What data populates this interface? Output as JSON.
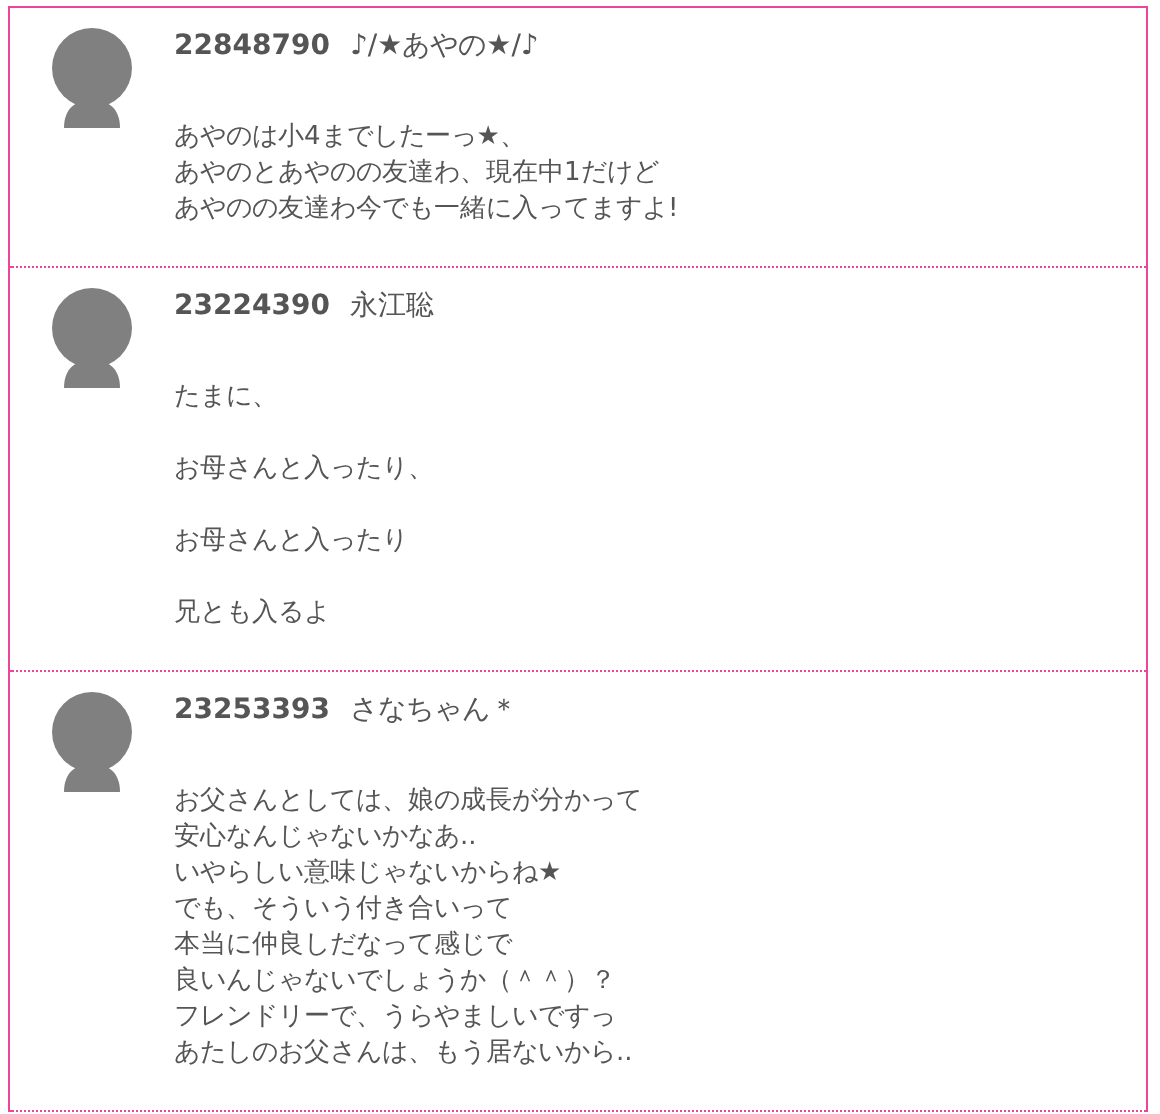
{
  "posts": [
    {
      "id": "22848790",
      "name": "♪/★あやの★/♪",
      "paragraphs": [
        [
          "あやのは小4までしたーっ★、",
          "あやのとあやのの友達わ、現在中1だけど",
          "あやのの友達わ今でも一緒に入ってますよ!"
        ]
      ]
    },
    {
      "id": "23224390",
      "name": "永江聡",
      "paragraphs": [
        [
          "たまに、"
        ],
        [
          "お母さんと入ったり、"
        ],
        [
          "お母さんと入ったり"
        ],
        [
          "兄とも入るよ"
        ]
      ]
    },
    {
      "id": "23253393",
      "name": "さなちゃん＊",
      "paragraphs": [
        [
          "お父さんとしては、娘の成長が分かって",
          "安心なんじゃないかなあ..",
          "いやらしい意味じゃないからね★",
          "でも、そういう付き合いって",
          "本当に仲良しだなって感じで",
          "良いんじゃないでしょうか（＾＾）？",
          "フレンドリーで、うらやましいですっ",
          "あたしのお父さんは、もう居ないから.."
        ]
      ]
    }
  ]
}
